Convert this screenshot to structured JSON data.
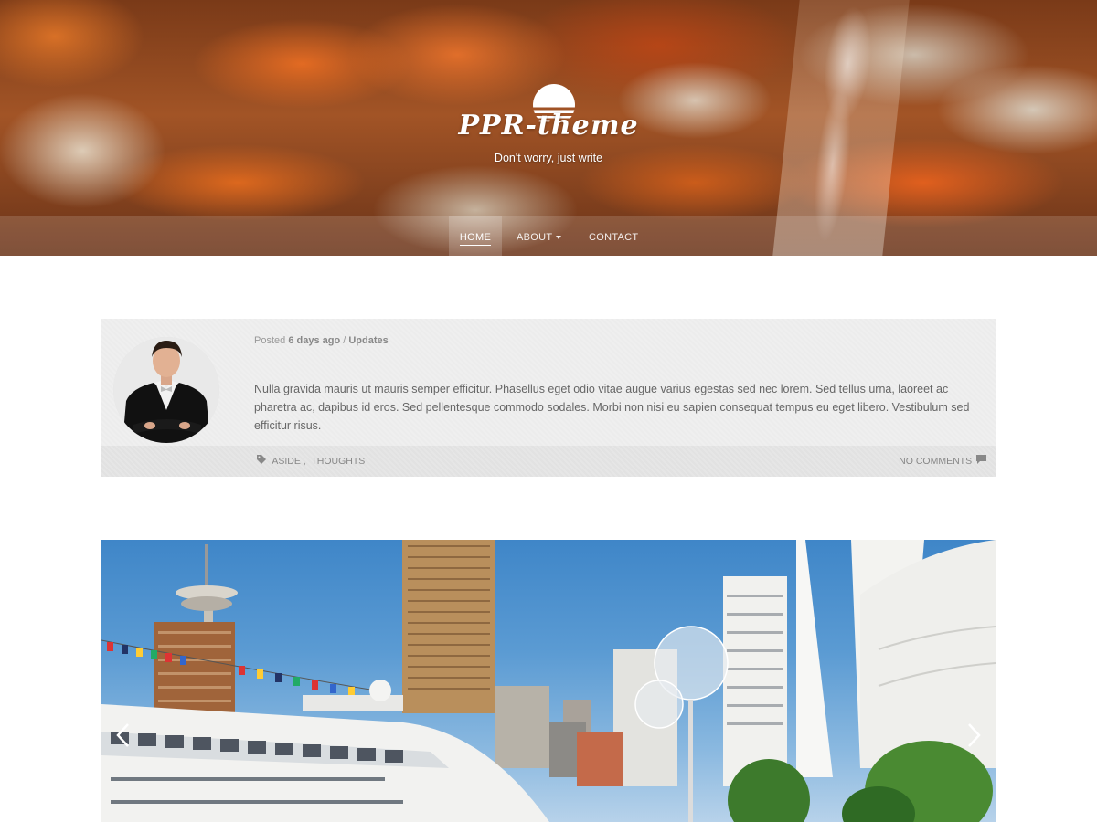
{
  "site": {
    "title": "PPR-theme",
    "tagline": "Don't worry, just write"
  },
  "nav": {
    "items": [
      {
        "label": "HOME",
        "active": true
      },
      {
        "label": "ABOUT",
        "has_dropdown": true
      },
      {
        "label": "CONTACT"
      }
    ]
  },
  "post": {
    "meta_prefix": "Posted",
    "time_ago": "6 days ago",
    "separator": "/",
    "category": "Updates",
    "excerpt": "Nulla gravida mauris ut mauris semper efficitur. Phasellus eget odio vitae augue varius egestas sed nec lorem. Sed tellus urna, laoreet ac pharetra ac, dapibus id eros. Sed pellentesque commodo sodales. Morbi non nisi eu sapien consequat tempus eu eget libero. Vestibulum sed efficitur risus.",
    "tags": [
      "ASIDE",
      "THOUGHTS"
    ],
    "tag_separator": ",",
    "comments_label": "NO COMMENTS"
  },
  "colors": {
    "post_bg": "#efefef",
    "post_footer_bg": "#e6e6e6",
    "text": "#666666",
    "meta": "#999999"
  },
  "icons": {
    "tag": "tag-icon",
    "comment": "comment-icon",
    "slider_prev": "chevron-left-icon",
    "slider_next": "chevron-right-icon"
  }
}
